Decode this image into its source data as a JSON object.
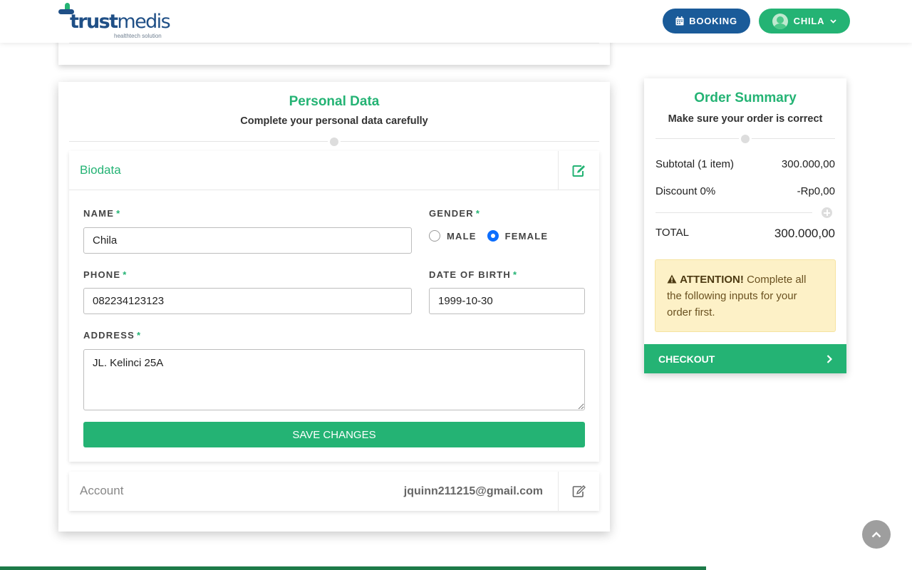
{
  "brand": {
    "name_bold": "trust",
    "name_light": "medis",
    "tagline": "healthtech solution",
    "colors": {
      "primary_green": "#24b374",
      "navy": "#1a5b99",
      "attention_bg": "#fdf1c7"
    }
  },
  "header": {
    "booking_label": "BOOKING",
    "booking_icon": "calendar-icon",
    "user_label": "CHILA",
    "user_icon": "avatar",
    "dropdown_icon": "chevron-down-icon"
  },
  "personal": {
    "title": "Personal Data",
    "subtitle": "Complete your personal data carefully",
    "biodata": {
      "title": "Biodata",
      "edit_icon": "edit-icon",
      "name_label": "NAME",
      "name_value": "Chila",
      "gender_label": "GENDER",
      "gender_options": [
        "MALE",
        "FEMALE"
      ],
      "gender_selected": "FEMALE",
      "phone_label": "PHONE",
      "phone_value": "082234123123",
      "dob_label": "DATE OF BIRTH",
      "dob_value": "1999-10-30",
      "address_label": "ADDRESS",
      "address_value": "JL. Kelinci 25A",
      "required_mark": "*",
      "save_label": "SAVE CHANGES"
    },
    "account": {
      "title": "Account",
      "email": "jquinn211215@gmail.com",
      "edit_icon": "edit-icon"
    }
  },
  "summary": {
    "title": "Order Summary",
    "subtitle": "Make sure your order is correct",
    "subtotal_label": "Subtotal (1 item)",
    "subtotal_value": "300.000,00",
    "discount_label": "Discount 0%",
    "discount_value": "-Rp0,00",
    "total_label": "TOTAL",
    "total_value": "300.000,00",
    "attention_title": "ATTENTION!",
    "attention_text": "Complete all the following inputs for your order first.",
    "checkout_label": "CHECKOUT"
  },
  "misc": {
    "scroll_top_icon": "chevron-up-icon"
  }
}
